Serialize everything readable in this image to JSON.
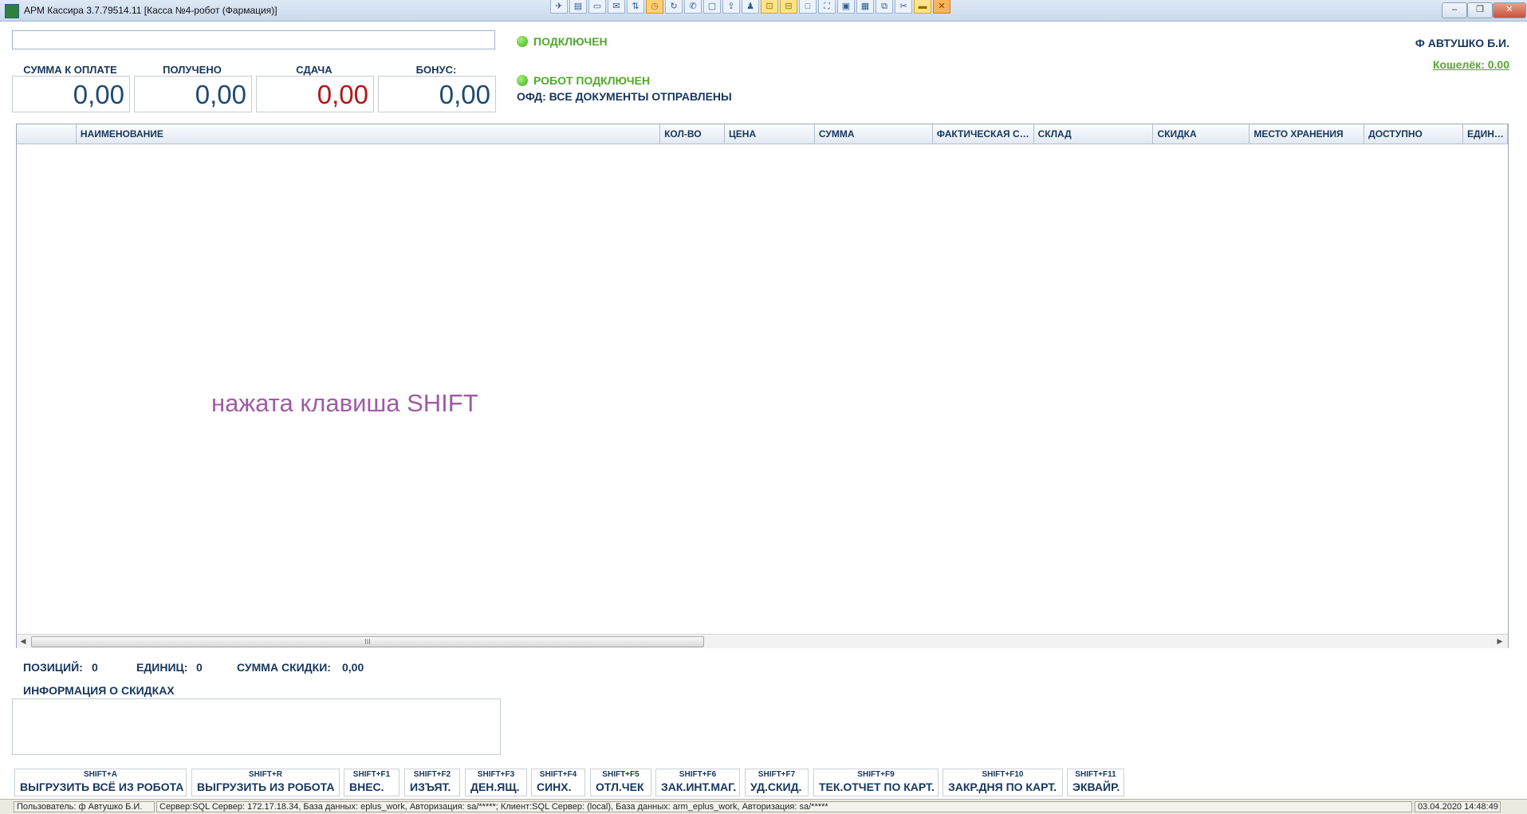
{
  "window": {
    "title": "АРМ Кассира 3.7.79514.11 [Касса №4-робот (Фармация)]",
    "min": "–",
    "max": "❐",
    "close": "✕"
  },
  "toolbar_icons": [
    "pin-icon",
    "printer-icon",
    "monitor-icon",
    "mail-icon",
    "sync-icon",
    "clock-icon",
    "refresh-icon",
    "phone-icon",
    "chat-icon",
    "upload-icon",
    "users-icon",
    "lock-icon",
    "unlock-icon",
    "window-icon",
    "expand-icon",
    "layout-icon",
    "grid-icon",
    "copy-icon",
    "tools-icon",
    "folder-icon",
    "exit-icon"
  ],
  "search": {
    "value": ""
  },
  "totals": [
    {
      "label": "СУММА К ОПЛАТЕ",
      "value": "0,00"
    },
    {
      "label": "ПОЛУЧЕНО",
      "value": "0,00"
    },
    {
      "label": "СДАЧА",
      "value": "0,00"
    },
    {
      "label": "БОНУС:",
      "value": "0,00"
    }
  ],
  "status": {
    "connected": "ПОДКЛЮЧЕН",
    "robot": "РОБОТ ПОДКЛЮЧЕН",
    "ofd": "ОФД: ВСЕ ДОКУМЕНТЫ ОТПРАВЛЕНЫ"
  },
  "user": {
    "name": "Ф АВТУШКО Б.И.",
    "wallet": "Кошелёк: 0.00"
  },
  "grid": {
    "columns": [
      "",
      "НАИМЕНОВАНИЕ",
      "КОЛ-ВО",
      "ЦЕНА",
      "СУММА",
      "ФАКТИЧЕСКАЯ СКИДКА",
      "СКЛАД",
      "СКИДКА",
      "МЕСТО ХРАНЕНИЯ",
      "ДОСТУПНО",
      "ЕДИНИЦЫ"
    ],
    "overlay": "нажата клавиша SHIFT",
    "scroll_grip": "III"
  },
  "summary": {
    "positions_label": "ПОЗИЦИЙ:",
    "positions": "0",
    "units_label": "ЕДИНИЦ:",
    "units": "0",
    "discount_label": "СУММА СКИДКИ:",
    "discount": "0,00",
    "discount_info": "ИНФОРМАЦИЯ О СКИДКАХ"
  },
  "fkeys": [
    {
      "shortcut": "SHIFT+A",
      "label": "ВЫГРУЗИТЬ ВСЁ ИЗ РОБОТА"
    },
    {
      "shortcut": "SHIFT+R",
      "label": "ВЫГРУЗИТЬ ИЗ РОБОТА"
    },
    {
      "shortcut": "SHIFT+F1",
      "label": "ВНЕС."
    },
    {
      "shortcut": "SHIFT+F2",
      "label": "ИЗЪЯТ."
    },
    {
      "shortcut": "SHIFT+F3",
      "label": "ДЕН.ЯЩ."
    },
    {
      "shortcut": "SHIFT+F4",
      "label": "СИНХ."
    },
    {
      "shortcut": "SHIFT+F5",
      "label": "ОТЛ.ЧЕК"
    },
    {
      "shortcut": "SHIFT+F6",
      "label": "ЗАК.ИНТ.МАГ."
    },
    {
      "shortcut": "SHIFT+F7",
      "label": "УД.СКИД."
    },
    {
      "shortcut": "SHIFT+F9",
      "label": "ТЕК.ОТЧЕТ ПО КАРТ."
    },
    {
      "shortcut": "SHIFT+F10",
      "label": "ЗАКР.ДНЯ ПО КАРТ."
    },
    {
      "shortcut": "SHIFT+F11",
      "label": "ЭКВАЙР."
    }
  ],
  "statusbar": {
    "user": "Пользователь: ф Автушко Б.И.",
    "server": "Сервер:SQL Сервер: 172.17.18.34,  База данных: eplus_work,  Авторизация: sa/*****;     Клиент:SQL Сервер: (local),  База данных: arm_eplus_work,  Авторизация: sa/*****",
    "datetime": "03.04.2020 14:48:49"
  },
  "colors": {
    "accent_green": "#4faa2a",
    "change_red": "#b01818",
    "label_navy": "#17365d",
    "overlay_purple": "#a05aa5"
  }
}
